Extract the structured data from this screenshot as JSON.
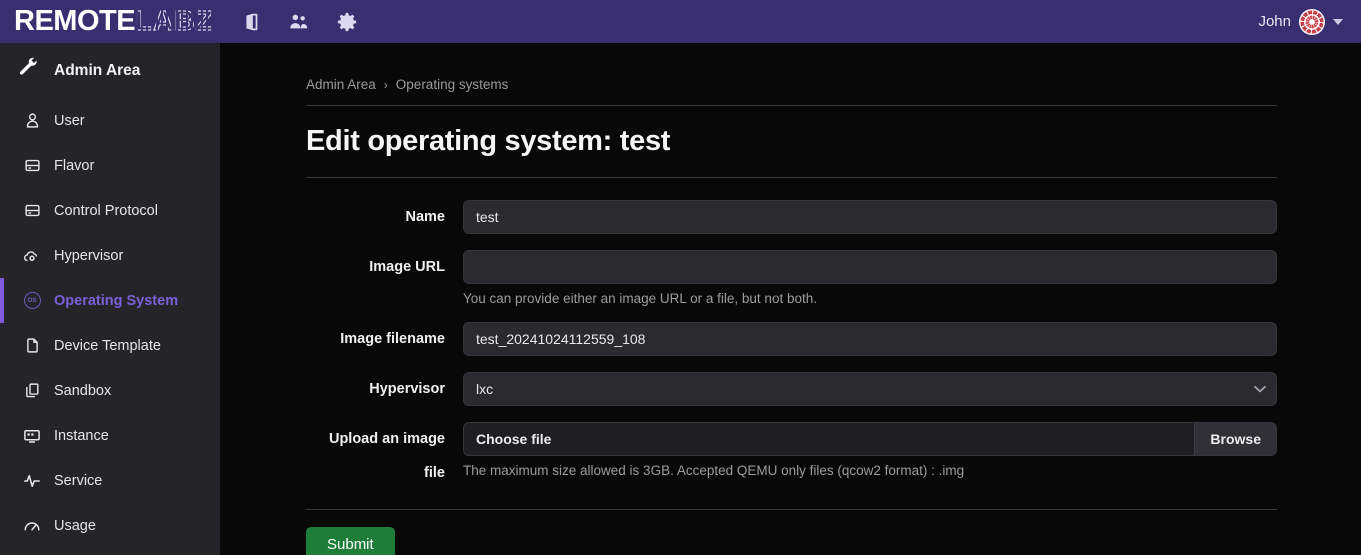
{
  "topbar": {
    "logo_primary": "REMOTE",
    "logo_secondary": "LABZ",
    "icons": [
      {
        "name": "door-icon",
        "label": "Door"
      },
      {
        "name": "users-icon",
        "label": "Users"
      },
      {
        "name": "gear-icon",
        "label": "Settings"
      }
    ],
    "user_name": "John",
    "background_color": "#382e70"
  },
  "sidebar": {
    "header": {
      "label": "Admin Area",
      "icon": "wrench-icon"
    },
    "items": [
      {
        "label": "User",
        "icon": "user-icon",
        "active": false
      },
      {
        "label": "Flavor",
        "icon": "server-icon",
        "active": false
      },
      {
        "label": "Control Protocol",
        "icon": "server-icon",
        "active": false
      },
      {
        "label": "Hypervisor",
        "icon": "cloud-cog-icon",
        "active": false
      },
      {
        "label": "Operating System",
        "icon": "os-circle-icon",
        "active": true
      },
      {
        "label": "Device Template",
        "icon": "file-icon",
        "active": false
      },
      {
        "label": "Sandbox",
        "icon": "copy-icon",
        "active": false
      },
      {
        "label": "Instance",
        "icon": "monitor-icon",
        "active": false
      },
      {
        "label": "Service",
        "icon": "activity-icon",
        "active": false
      },
      {
        "label": "Usage",
        "icon": "gauge-icon",
        "active": false
      }
    ],
    "active_color": "#7b5fd8",
    "background_color": "#242429"
  },
  "breadcrumb": {
    "items": [
      "Admin Area",
      "Operating systems"
    ],
    "separator": "›"
  },
  "page": {
    "title": "Edit operating system: test"
  },
  "form": {
    "name": {
      "label": "Name",
      "value": "test",
      "placeholder": ""
    },
    "image_url": {
      "label": "Image URL",
      "value": "",
      "placeholder": "",
      "help": "You can provide either an image URL or a file, but not both."
    },
    "image_filename": {
      "label": "Image filename",
      "value": "test_20241024112559_108",
      "placeholder": ""
    },
    "hypervisor": {
      "label": "Hypervisor",
      "selected": "lxc",
      "options": [
        "lxc"
      ]
    },
    "upload": {
      "label": "Upload an image file",
      "choose_text": "Choose file",
      "browse_text": "Browse",
      "help": "The maximum size allowed is 3GB. Accepted QEMU only files (qcow2 format) : .img"
    },
    "submit_label": "Submit",
    "submit_color": "#1e7e39"
  }
}
